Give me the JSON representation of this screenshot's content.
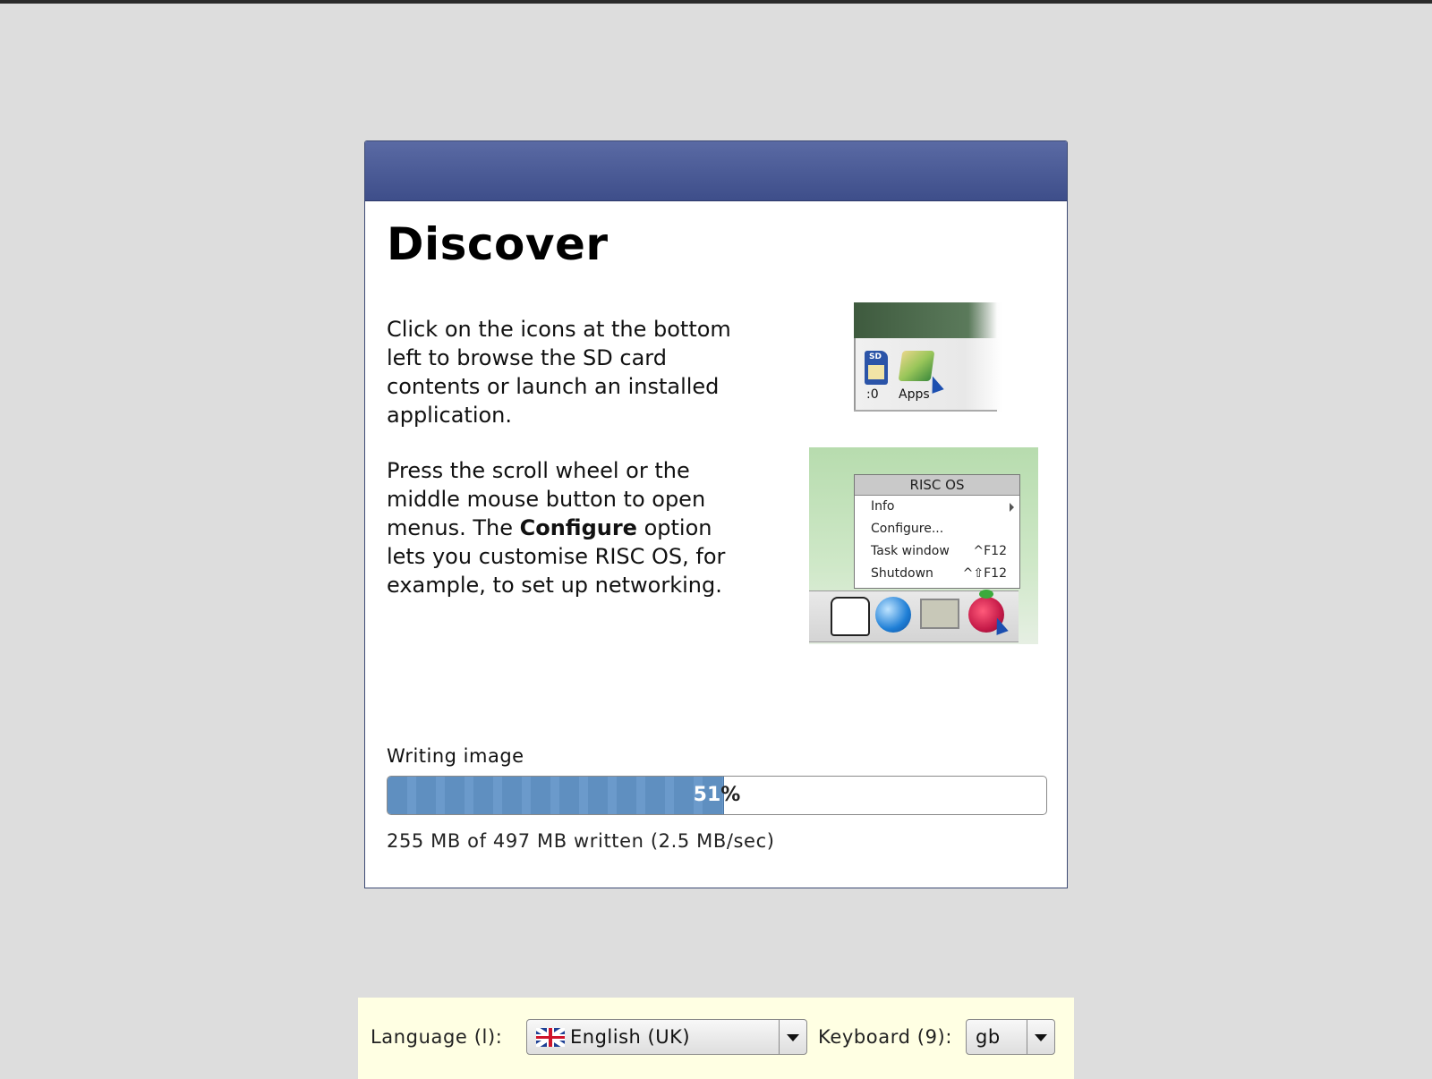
{
  "slide": {
    "title": "Discover",
    "para1": "Click on the icons at the bottom left to browse the SD card contents or launch an installed application.",
    "para2_pre": "Press the scroll wheel or the middle mouse button to open menus. The ",
    "para2_bold": "Configure",
    "para2_post": " option lets you customise RISC OS, for example, to set up networking."
  },
  "illustration1": {
    "sd_label": "SD",
    "sd_caption": ":0",
    "apps_caption": "Apps"
  },
  "illustration2": {
    "menu_title": "RISC OS",
    "items": [
      {
        "label": "Info",
        "shortcut": ""
      },
      {
        "label": "Configure...",
        "shortcut": ""
      },
      {
        "label": "Task window",
        "shortcut": "^F12"
      },
      {
        "label": "Shutdown",
        "shortcut": "^⇧F12"
      }
    ]
  },
  "progress": {
    "status": "Writing image",
    "percent": 51,
    "percent_head": "51",
    "percent_tail": "%",
    "detail": "255 MB of 497 MB written (2.5 MB/sec)"
  },
  "language_bar": {
    "language_label": "Language (l):",
    "language_value": "English (UK)",
    "keyboard_label": "Keyboard (9):",
    "keyboard_value": "gb"
  },
  "colors": {
    "titlebar": "#4a5a96",
    "progress_fill": "#6b9acb",
    "language_bar_bg": "#ffffe3"
  }
}
